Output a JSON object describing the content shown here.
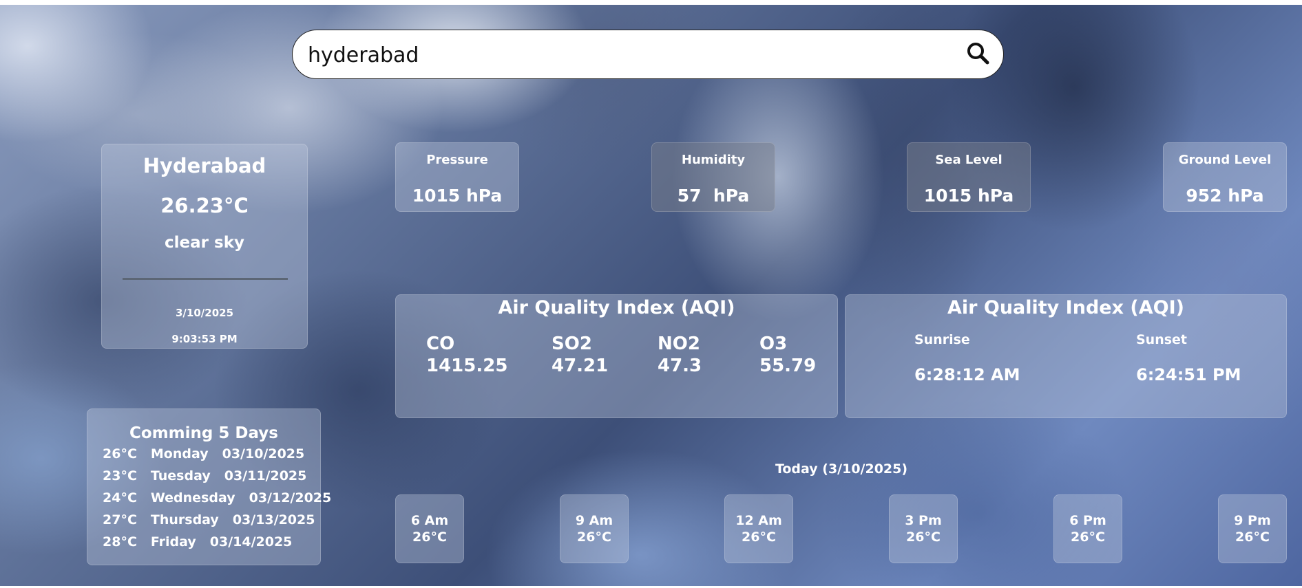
{
  "search": {
    "value": "hyderabad",
    "icon": "search-icon"
  },
  "city": {
    "name": "Hyderabad",
    "temp": "26.23°C",
    "description": "clear sky",
    "date": "3/10/2025",
    "time": "9:03:53 PM"
  },
  "stats": [
    {
      "label": "Pressure",
      "value": "1015 hPa"
    },
    {
      "label": "Humidity",
      "value": "57  hPa"
    },
    {
      "label": "Sea Level",
      "value": "1015 hPa"
    },
    {
      "label": "Ground Level",
      "value": "952 hPa"
    }
  ],
  "aqi": {
    "title": "Air Quality Index (AQI)",
    "pollutants": [
      {
        "name": "CO",
        "value": "1415.25"
      },
      {
        "name": "SO2",
        "value": "47.21"
      },
      {
        "name": "NO2",
        "value": "47.3"
      },
      {
        "name": "O3",
        "value": "55.79"
      }
    ]
  },
  "sun": {
    "title": "Air Quality Index (AQI)",
    "sunrise_label": "Sunrise",
    "sunrise": "6:28:12 AM",
    "sunset_label": "Sunset",
    "sunset": "6:24:51 PM"
  },
  "forecast": {
    "title": "Comming 5 Days",
    "days": [
      {
        "temp": "26°C",
        "day": "Monday",
        "date": "03/10/2025"
      },
      {
        "temp": "23°C",
        "day": "Tuesday",
        "date": "03/11/2025"
      },
      {
        "temp": "24°C",
        "day": "Wednesday",
        "date": "03/12/2025"
      },
      {
        "temp": "27°C",
        "day": "Thursday",
        "date": "03/13/2025"
      },
      {
        "temp": "28°C",
        "day": "Friday",
        "date": "03/14/2025"
      }
    ]
  },
  "today": {
    "label": "Today (3/10/2025)",
    "hours": [
      {
        "time": "6 Am",
        "temp": "26°C"
      },
      {
        "time": "9 Am",
        "temp": "26°C"
      },
      {
        "time": "12 Am",
        "temp": "26°C"
      },
      {
        "time": "3 Pm",
        "temp": "26°C"
      },
      {
        "time": "6 Pm",
        "temp": "26°C"
      },
      {
        "time": "9 Pm",
        "temp": "26°C"
      }
    ]
  }
}
